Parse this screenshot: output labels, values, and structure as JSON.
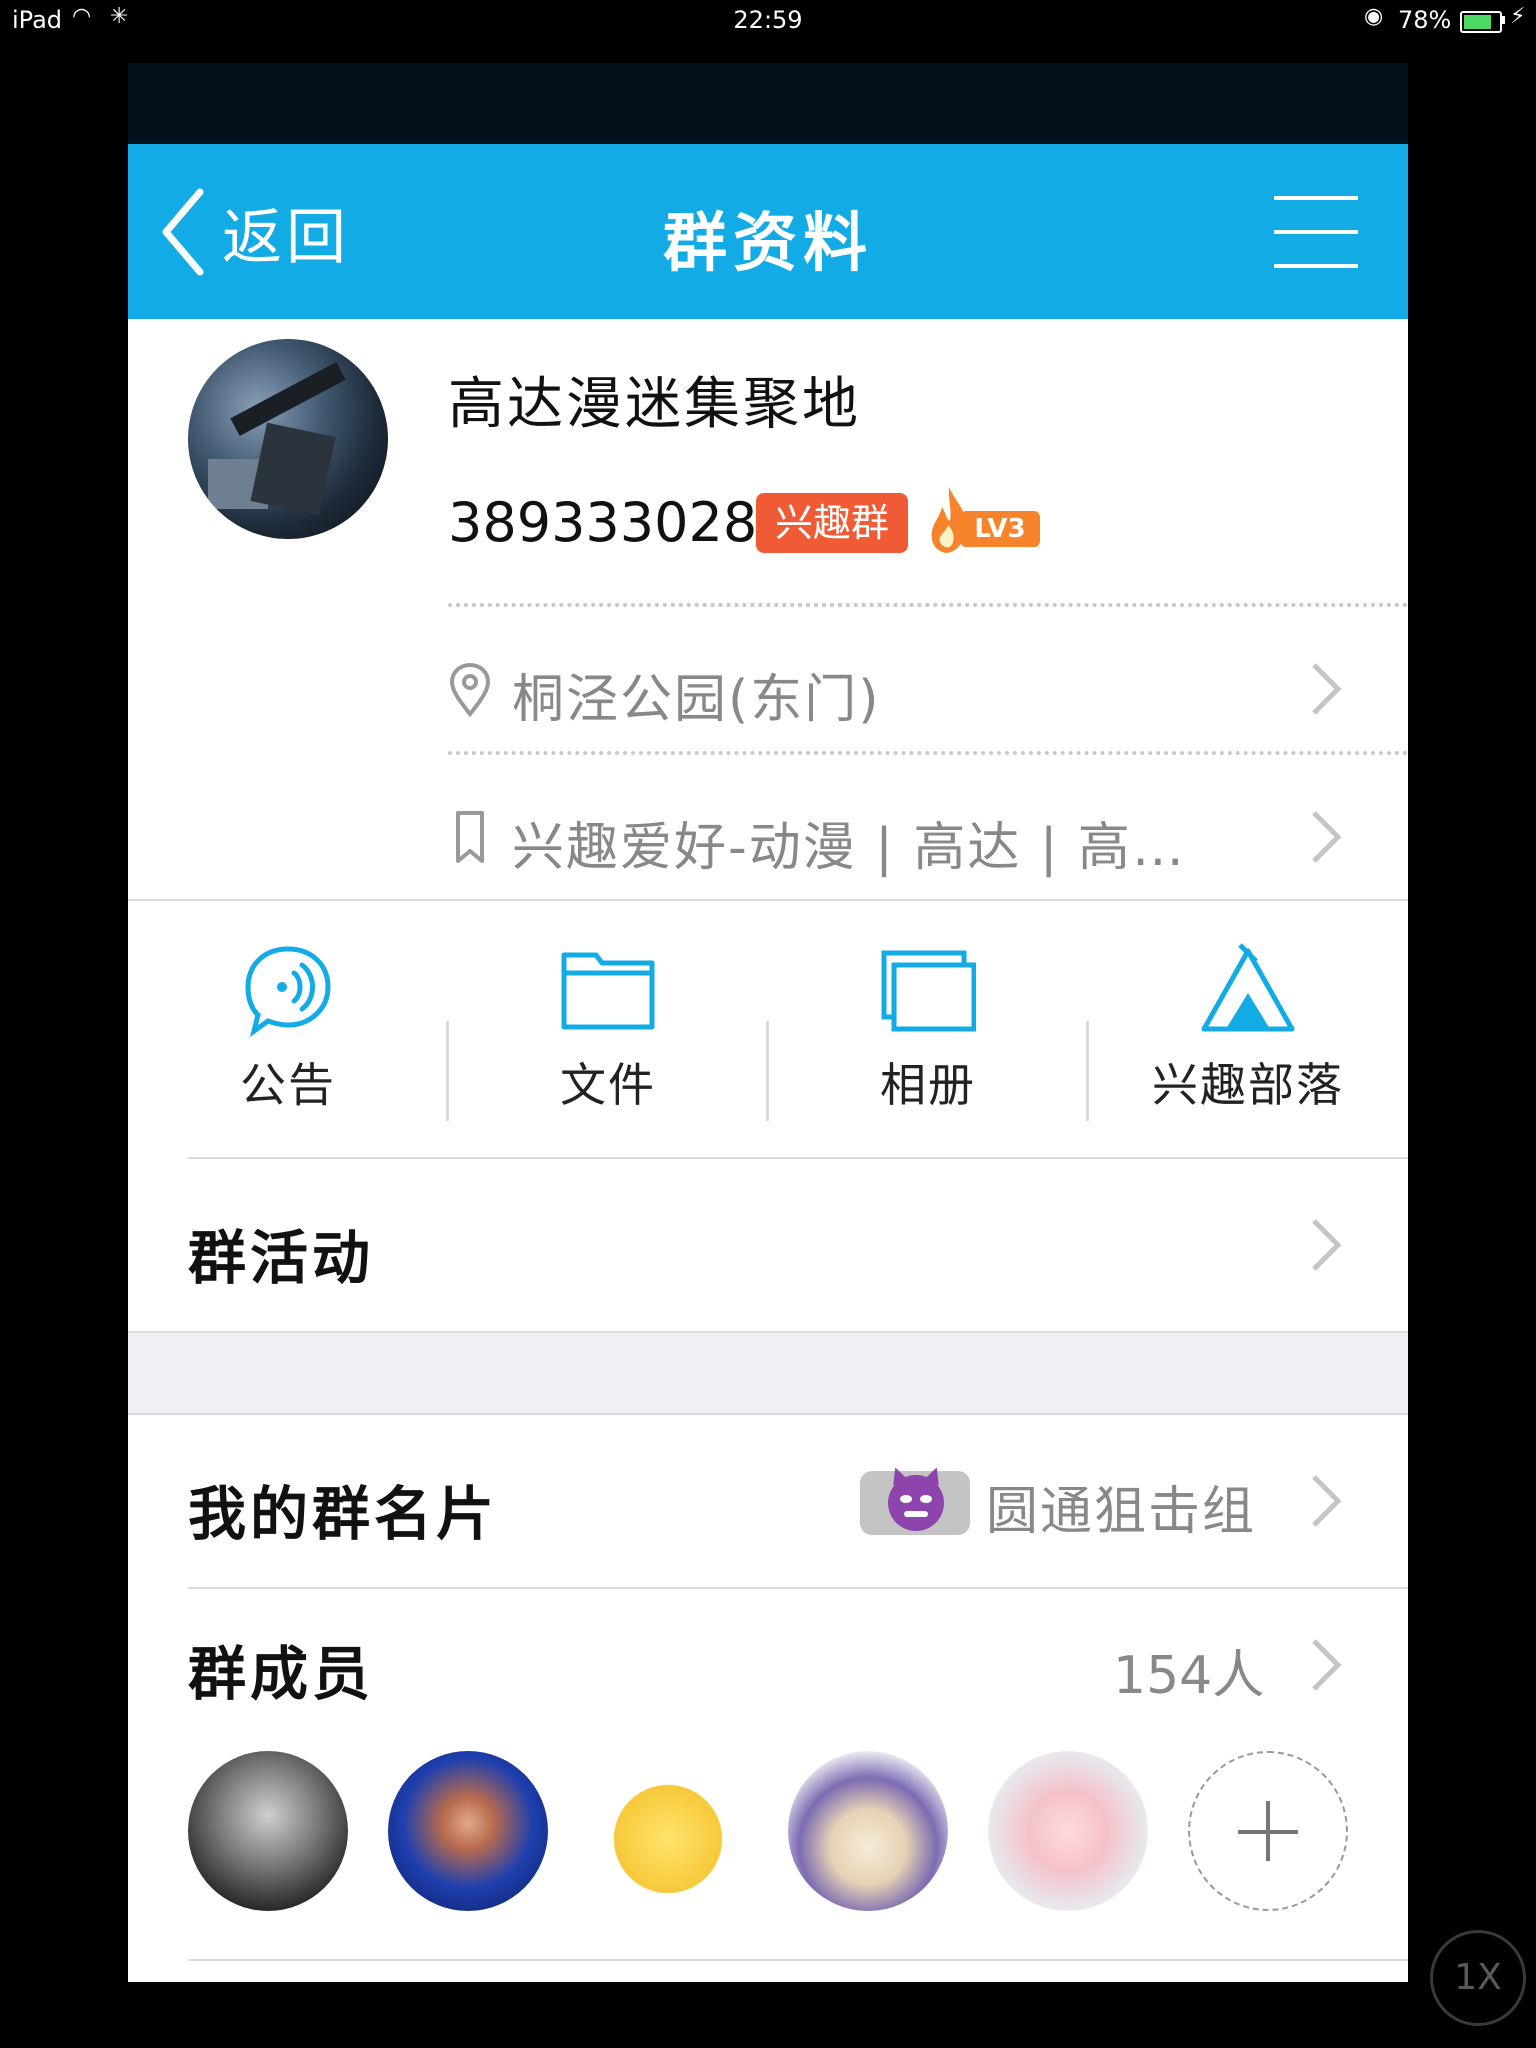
{
  "status_bar": {
    "device": "iPad",
    "wifi_icon": "wifi-icon",
    "time": "22:59",
    "battery": "78%",
    "battery_level": 0.78
  },
  "navbar": {
    "back_label": "返回",
    "title": "群资料",
    "menu_icon": "hamburger-menu-icon",
    "background": "#12abe5"
  },
  "group": {
    "name": "高达漫迷集聚地",
    "id": "389333028",
    "tag": "兴趣群",
    "level": "LV3",
    "location": "桐泾公园(东门)",
    "category": "兴趣爱好-动漫 | 高达 | 高…"
  },
  "actions": [
    {
      "label": "公告",
      "icon": "announcement-icon"
    },
    {
      "label": "文件",
      "icon": "folder-icon"
    },
    {
      "label": "相册",
      "icon": "album-icon"
    },
    {
      "label": "兴趣部落",
      "icon": "tent-icon"
    }
  ],
  "rows": {
    "activity": "群活动",
    "my_card": {
      "label": "我的群名片",
      "value": "圆通狙击组"
    },
    "members": {
      "label": "群成员",
      "count": "154人"
    }
  },
  "zoom_label": "1X",
  "colors": {
    "accent": "#12abe5",
    "tag": "#f05b36",
    "level": "#f7842a"
  }
}
